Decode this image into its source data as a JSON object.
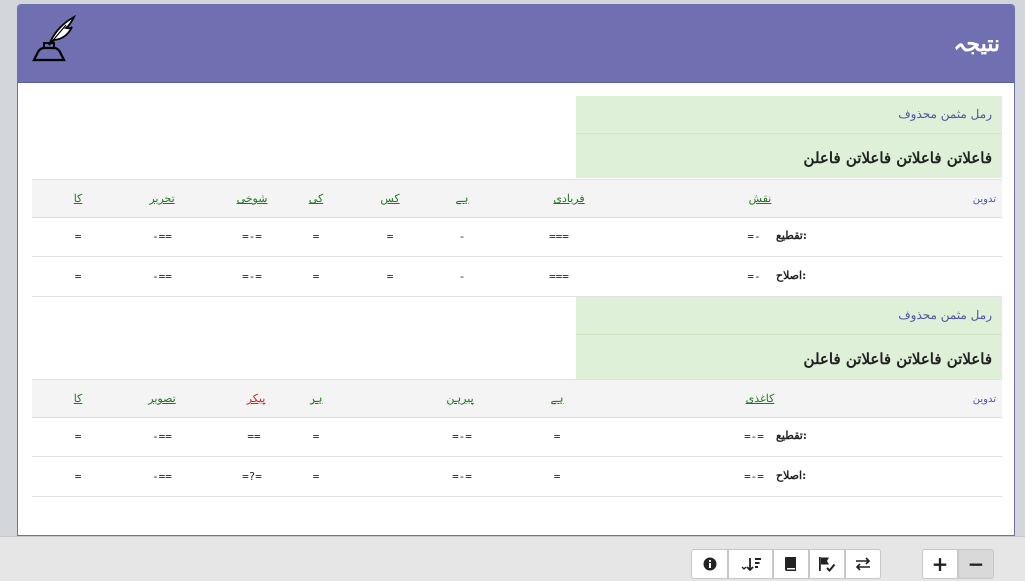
{
  "header": {
    "title": "نتیجہ",
    "logo_icon": "quill-inkpot-icon"
  },
  "sections": [
    {
      "meter_name": "رمل مثمن محذوف",
      "meter_feet": "فاعلاتن فاعلاتن فاعلاتن فاعلن",
      "tadveen_label": "تدوین",
      "words": [
        "نقش",
        "فریادی",
        "ہے",
        "کس",
        "کی",
        "شوخی",
        "تحریر",
        "کا"
      ],
      "scans": [
        {
          "label": "تقطیع:",
          "values": [
            "=-",
            "===",
            "-",
            "=",
            "=",
            "=-=",
            "-==",
            "="
          ]
        },
        {
          "label": "اصلاح:",
          "values": [
            "=-",
            "===",
            "-",
            "=",
            "=",
            "=-=",
            "-==",
            "="
          ]
        }
      ]
    },
    {
      "meter_name": "رمل مثمن محذوف",
      "meter_feet": "فاعلاتن فاعلاتن فاعلاتن فاعلن",
      "tadveen_label": "تدوین",
      "words": [
        "کاغذی",
        "ہے",
        "پیرہن",
        "ہر",
        "پیکر",
        "تصویر",
        "کا"
      ],
      "error_words": [
        "پیکر"
      ],
      "scans": [
        {
          "label": "تقطیع:",
          "values": [
            "=-=",
            "=",
            "=-=",
            "=",
            "==",
            "-==",
            "="
          ]
        },
        {
          "label": "اصلاح:",
          "values": [
            "=-=",
            "=",
            "=-=",
            "=",
            "=?=",
            "-==",
            "="
          ]
        }
      ]
    }
  ],
  "toolbar": {
    "buttons": [
      "info-icon",
      "sort-icon",
      "book-icon",
      "flag-check-icon",
      "swap-icon"
    ],
    "zoom_in": "+",
    "zoom_out": "−"
  }
}
